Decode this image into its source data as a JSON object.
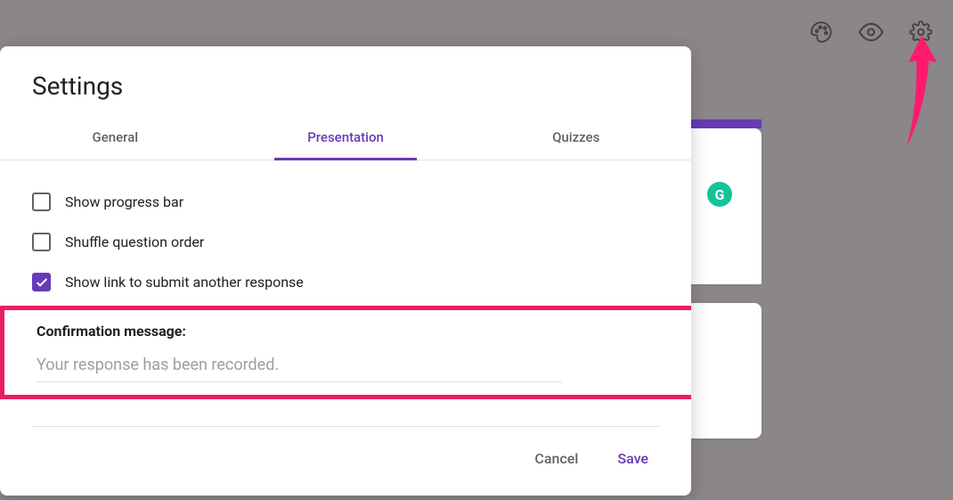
{
  "modal": {
    "title": "Settings",
    "tabs": {
      "general": "General",
      "presentation": "Presentation",
      "quizzes": "Quizzes"
    },
    "options": {
      "show_progress_bar": "Show progress bar",
      "shuffle_questions": "Shuffle question order",
      "show_submit_link": "Show link to submit another response"
    },
    "confirmation": {
      "label": "Confirmation message:",
      "placeholder": "Your response has been recorded."
    },
    "actions": {
      "cancel": "Cancel",
      "save": "Save"
    }
  },
  "bg": {
    "grammarly_badge": "G"
  },
  "colors": {
    "accent": "#673ab7",
    "highlight": "#e91e63"
  }
}
